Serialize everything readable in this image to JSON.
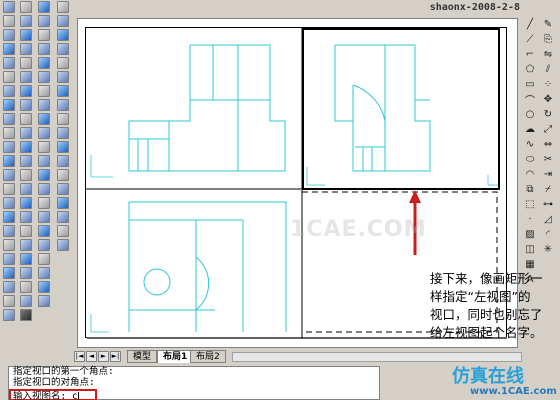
{
  "header": {
    "stamp": "shaonx-2008-2-8"
  },
  "tabs": {
    "nav": [
      "|◄",
      "◄",
      "►",
      "►|"
    ],
    "items": [
      {
        "label": "模型",
        "active": false
      },
      {
        "label": "布局1",
        "active": true
      },
      {
        "label": "布局2",
        "active": false
      }
    ]
  },
  "annotation": {
    "line1": "接下来，像画矩形一",
    "line2": "样指定“左视图”的",
    "line3": "视口，同时也别忘了",
    "line4": "给左视图起个名字。"
  },
  "watermark": "1CAE.COM",
  "command": {
    "history": [
      "指定视口的第一个角点:",
      "指定视口的对角点:"
    ],
    "prompt": "输入视图名:",
    "input_value": "c"
  },
  "logo": {
    "text": "仿真在线",
    "url": "www.1CAE.com"
  },
  "colors": {
    "drawing": "#2fc7d6",
    "arrow": "#c81e1e",
    "highlight": "#d21a1a"
  }
}
